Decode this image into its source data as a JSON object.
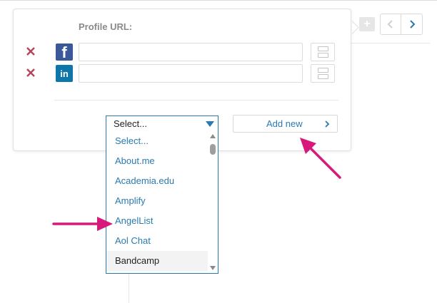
{
  "popup": {
    "profile_url_label": "Profile URL:",
    "profiles": [
      {
        "network": "facebook",
        "badge": "f",
        "icon": "facebook-icon",
        "url_value": ""
      },
      {
        "network": "linkedin",
        "badge": "in",
        "icon": "linkedin-icon",
        "url_value": ""
      }
    ],
    "remove_icon": "close-icon",
    "reorder_icon": "drag-handle-icon"
  },
  "select": {
    "value": "Select...",
    "options": [
      "Select...",
      "About.me",
      "Academia.edu",
      "Amplify",
      "AngelList",
      "Aol Chat",
      "Bandcamp"
    ],
    "highlighted_option": "Bandcamp"
  },
  "add_new": {
    "label": "Add new"
  },
  "nav": {
    "plus_icon": "plus-icon",
    "prev_icon": "chevron-left-icon",
    "next_icon": "chevron-right-icon"
  },
  "colors": {
    "accent": "#2a7ab0",
    "remove": "#b5425d",
    "annotation_arrow": "#d6197a",
    "facebook": "#3b5998",
    "linkedin": "#0e76a8"
  }
}
